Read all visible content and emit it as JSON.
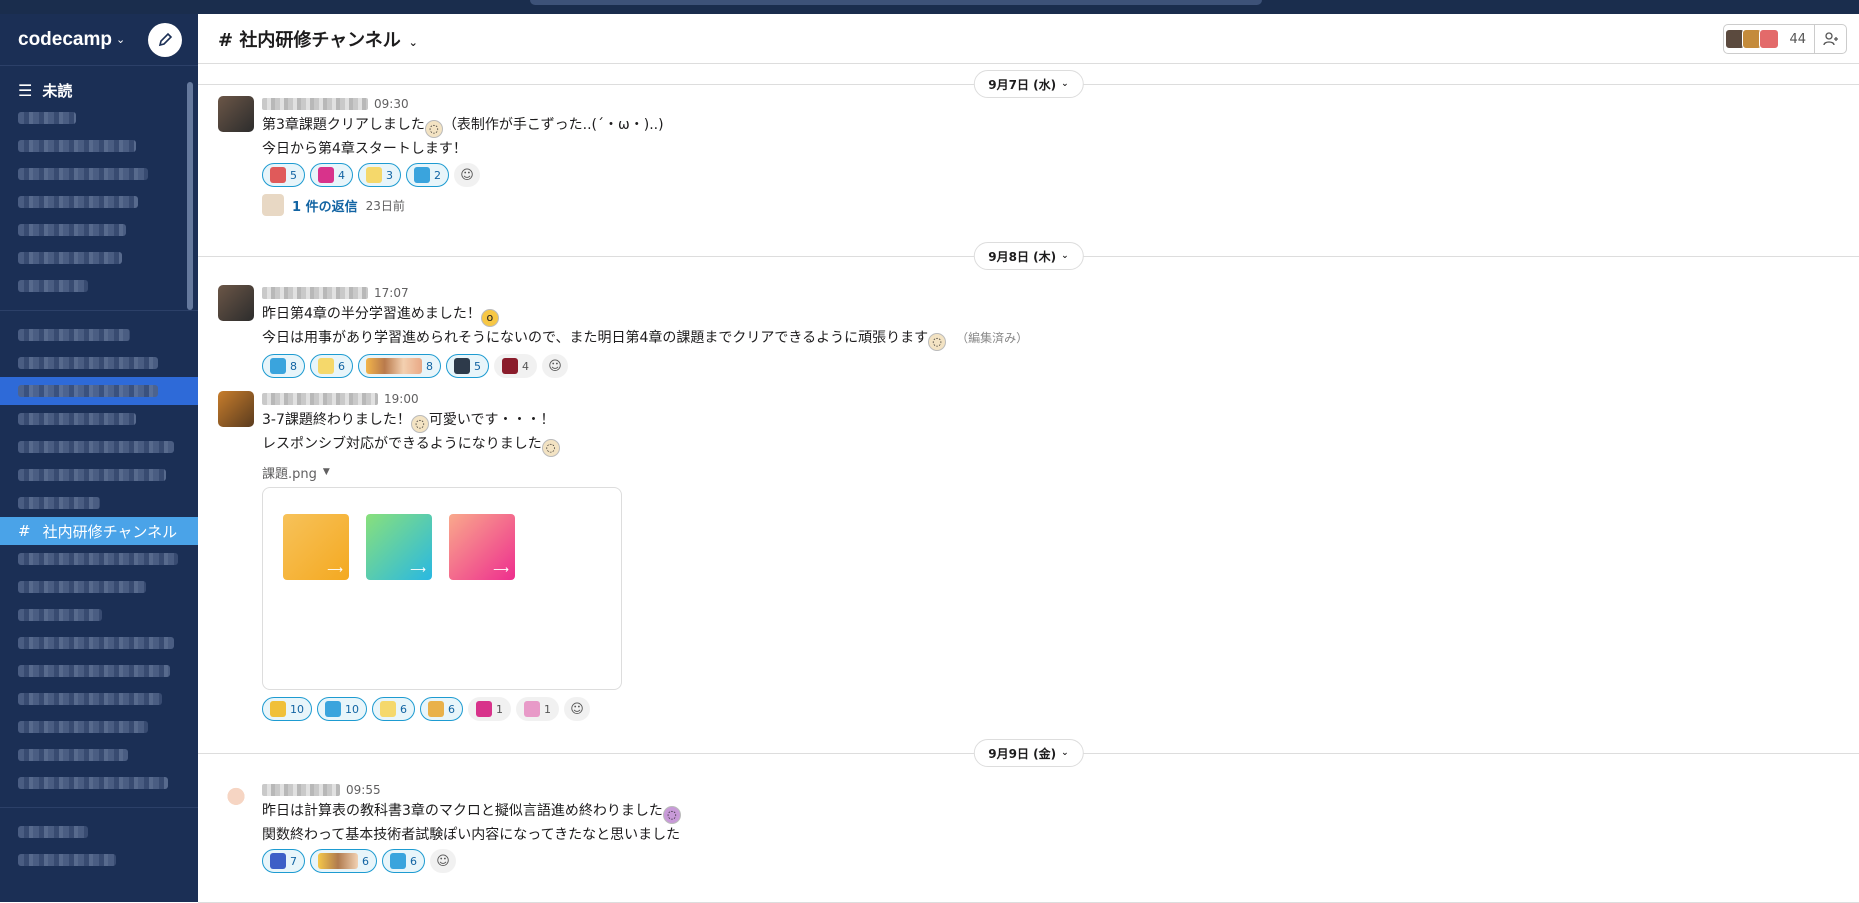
{
  "workspace": {
    "name": "codecamp"
  },
  "sidebar": {
    "unread_label": "未読",
    "selected_channel": "社内研修チャンネル"
  },
  "channel": {
    "title": "# 社内研修チャンネル",
    "member_count": "44"
  },
  "days": [
    {
      "label": "9月7日 (水)"
    },
    {
      "label": "9月8日 (木)"
    },
    {
      "label": "9月9日 (金)"
    }
  ],
  "messages": [
    {
      "time": "09:30",
      "lines": [
        "第3章課題クリアしました",
        "（表制作が手こずった..(´・ω・)..)",
        "今日から第4章スタートします！"
      ],
      "reactions": [
        "5",
        "4",
        "3",
        "2"
      ],
      "thread": {
        "replies": "1 件の返信",
        "ago": "23日前"
      }
    },
    {
      "time": "17:07",
      "lines": [
        "昨日第4章の半分学習進めました！",
        "今日は用事があり学習進められそうにないので、また明日第4章の課題までクリアできるように頑張ります"
      ],
      "edited": "（編集済み）",
      "reactions": [
        "8",
        "6",
        "8",
        "5",
        "4"
      ]
    },
    {
      "time": "19:00",
      "lines": [
        "3-7課題終わりました！",
        "可愛いです・・・！",
        "レスポンシブ対応ができるようになりました"
      ],
      "file": "課題.png",
      "reactions": [
        "10",
        "10",
        "6",
        "6",
        "1",
        "1"
      ]
    },
    {
      "time": "09:55",
      "lines": [
        "昨日は計算表の教科書3章のマクロと擬似言語進め終わりました",
        "関数終わって基本技術者試験ぽい内容になってきたなと思いました"
      ],
      "reactions": [
        "7",
        "6",
        "6"
      ]
    }
  ],
  "colors": {
    "sidebar": "#1b2f55",
    "selected": "#4aa3e8",
    "accent_link": "#1264a3"
  }
}
